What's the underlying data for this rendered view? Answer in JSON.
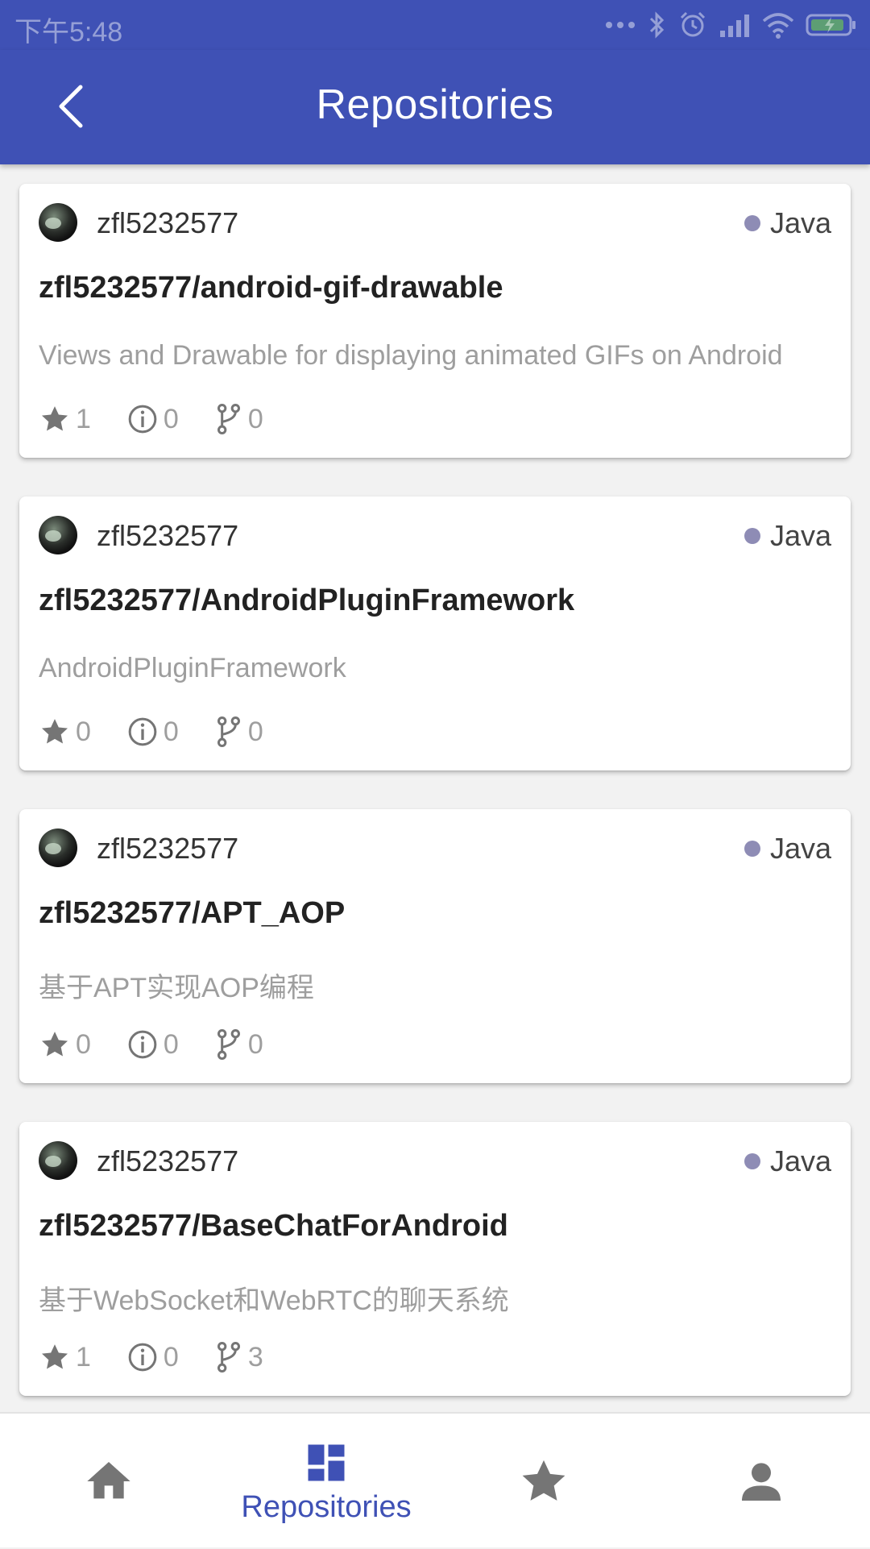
{
  "status_bar": {
    "time": "下午5:48"
  },
  "app_bar": {
    "title": "Repositories"
  },
  "colors": {
    "primary": "#3f51b5",
    "java": "#8e8cb5",
    "icon_gray": "#757575"
  },
  "repos": [
    {
      "owner": "zfl5232577",
      "language": "Java",
      "name": "zfl5232577/android-gif-drawable",
      "description": "Views and Drawable for displaying animated GIFs on Android",
      "stars": "1",
      "issues": "0",
      "forks": "0"
    },
    {
      "owner": "zfl5232577",
      "language": "Java",
      "name": "zfl5232577/AndroidPluginFramework",
      "description": "AndroidPluginFramework",
      "stars": "0",
      "issues": "0",
      "forks": "0"
    },
    {
      "owner": "zfl5232577",
      "language": "Java",
      "name": "zfl5232577/APT_AOP",
      "description": "基于APT实现AOP编程",
      "stars": "0",
      "issues": "0",
      "forks": "0"
    },
    {
      "owner": "zfl5232577",
      "language": "Java",
      "name": "zfl5232577/BaseChatForAndroid",
      "description": "基于WebSocket和WebRTC的聊天系统",
      "stars": "1",
      "issues": "0",
      "forks": "3"
    }
  ],
  "bottom_nav": {
    "selected": "Repositories",
    "items": [
      {
        "icon": "home-icon"
      },
      {
        "icon": "dashboard-icon",
        "label": "Repositories"
      },
      {
        "icon": "star-icon"
      },
      {
        "icon": "person-icon"
      }
    ]
  }
}
